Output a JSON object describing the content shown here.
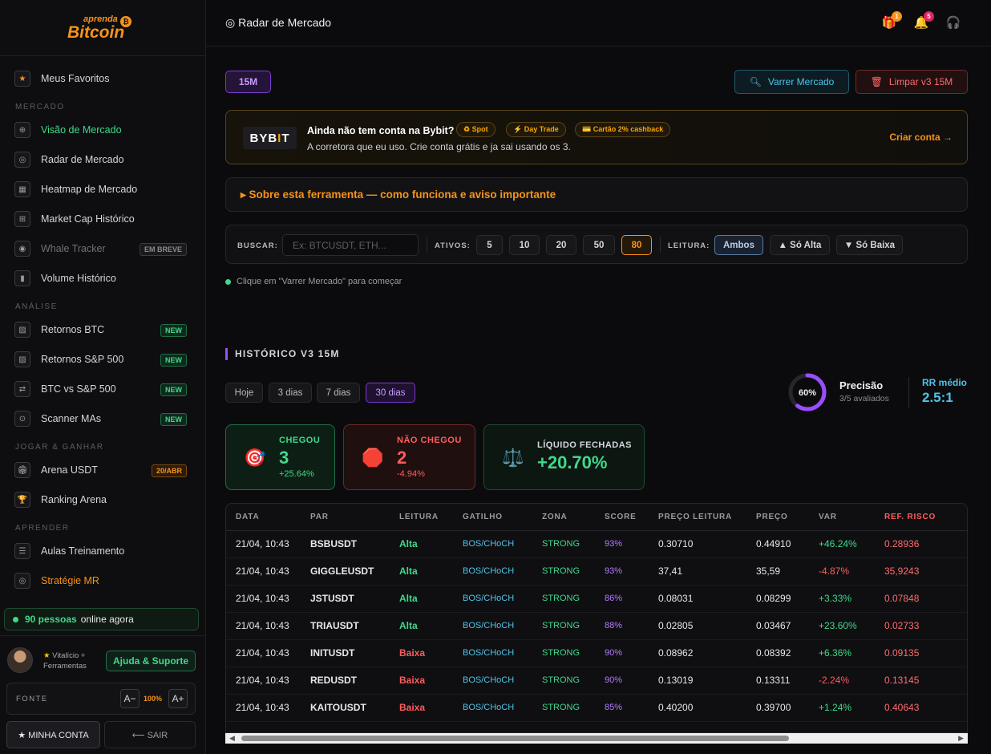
{
  "logo": {
    "top": "aprenda",
    "main": "Bitcoin",
    "coin": "₿"
  },
  "sidebar": {
    "favorites": "Meus Favoritos",
    "sections": {
      "mercado": "MERCADO",
      "analise": "ANÁLISE",
      "jogar": "JOGAR & GANHAR",
      "aprender": "APRENDER"
    },
    "items": [
      {
        "label": "Visão de Mercado",
        "color": "#3fd98a"
      },
      {
        "label": "Radar de Mercado"
      },
      {
        "label": "Heatmap de Mercado"
      },
      {
        "label": "Market Cap Histórico"
      },
      {
        "label": "Whale Tracker",
        "badge": "EM BREVE"
      },
      {
        "label": "Volume Histórico"
      },
      {
        "label": "Retornos BTC",
        "badge": "NEW"
      },
      {
        "label": "Retornos S&P 500",
        "badge": "NEW"
      },
      {
        "label": "BTC vs S&P 500",
        "badge": "NEW"
      },
      {
        "label": "Scanner MAs",
        "badge": "NEW"
      },
      {
        "label": "Arena USDT",
        "badge": "20/ABR"
      },
      {
        "label": "Ranking Arena"
      },
      {
        "label": "Aulas Treinamento"
      },
      {
        "label": "Stratégie MR",
        "color": "#f7931a"
      }
    ],
    "online_count": "90 pessoas",
    "online_text": "online agora",
    "plan_line1": "Vitalício +",
    "plan_line2": "Ferramentas",
    "help": "Ajuda & Suporte",
    "font_label": "FONTE",
    "font_minus": "A−",
    "font_pct": "100%",
    "font_plus": "A+",
    "account": "★ MINHA CONTA",
    "logout": "⟵ SAIR"
  },
  "topbar": {
    "title": "◎ Radar de Mercado",
    "gift_count": "1",
    "bell_count": "5"
  },
  "controls": {
    "timeframe": "15M",
    "sweep": "Varrer Mercado",
    "clear": "Limpar v3 15M"
  },
  "promo": {
    "brand_a": "BYB",
    "brand_b": "I",
    "brand_c": "T",
    "title": "Ainda não tem conta na Bybit?",
    "chips": [
      "♻ Spot",
      "⚡ Day Trade",
      "💳 Cartão 2% cashback"
    ],
    "subtitle": "A corretora que eu uso. Crie conta grátis e ja sai usando os 3.",
    "cta": "Criar conta →"
  },
  "about": "▸ Sobre esta ferramenta — como funciona e aviso importante",
  "filters": {
    "search_label": "BUSCAR:",
    "search_placeholder": "Ex: BTCUSDT, ETH...",
    "assets_label": "ATIVOS:",
    "assets": [
      "5",
      "10",
      "20",
      "50",
      "80"
    ],
    "assets_selected": "80",
    "reading_label": "LEITURA:",
    "readings": [
      "Ambos",
      "▲ Só Alta",
      "▼ Só Baixa"
    ]
  },
  "hint": "Clique em \"Varrer Mercado\" para começar",
  "history": {
    "title": "HISTÓRICO V3 15M",
    "ranges": [
      "Hoje",
      "3 dias",
      "7 dias",
      "30 dias"
    ],
    "range_selected": "30 dias",
    "precision_pct": "60%",
    "precision_value": 0.6,
    "precision_label": "Precisão",
    "precision_sub": "3/5 avaliados",
    "rr_label": "RR médio",
    "rr_value": "2.5:1"
  },
  "cards": {
    "hit": {
      "icon": "🎯",
      "title": "CHEGOU",
      "value": "3",
      "sub": "+25.64%"
    },
    "miss": {
      "icon": "🛑",
      "title": "NÃO CHEGOU",
      "value": "2",
      "sub": "-4.94%"
    },
    "net": {
      "icon": "⚖️",
      "title": "LÍQUIDO FECHADAS",
      "value": "+20.70%"
    }
  },
  "table": {
    "headers": [
      "DATA",
      "PAR",
      "LEITURA",
      "GATILHO",
      "ZONA",
      "SCORE",
      "PREÇO LEITURA",
      "PREÇO",
      "VAR",
      "REF. RISCO"
    ],
    "rows": [
      [
        "21/04, 10:43",
        "BSBUSDT",
        "Alta",
        "BOS/CHoCH",
        "STRONG",
        "93%",
        "0.30710",
        "0.44910",
        "+46.24%",
        "0.28936"
      ],
      [
        "21/04, 10:43",
        "GIGGLEUSDT",
        "Alta",
        "BOS/CHoCH",
        "STRONG",
        "93%",
        "37,41",
        "35,59",
        "-4.87%",
        "35,9243"
      ],
      [
        "21/04, 10:43",
        "JSTUSDT",
        "Alta",
        "BOS/CHoCH",
        "STRONG",
        "86%",
        "0.08031",
        "0.08299",
        "+3.33%",
        "0.07848"
      ],
      [
        "21/04, 10:43",
        "TRIAUSDT",
        "Alta",
        "BOS/CHoCH",
        "STRONG",
        "88%",
        "0.02805",
        "0.03467",
        "+23.60%",
        "0.02733"
      ],
      [
        "21/04, 10:43",
        "INITUSDT",
        "Baixa",
        "BOS/CHoCH",
        "STRONG",
        "90%",
        "0.08962",
        "0.08392",
        "+6.36%",
        "0.09135"
      ],
      [
        "21/04, 10:43",
        "REDUSDT",
        "Baixa",
        "BOS/CHoCH",
        "STRONG",
        "90%",
        "0.13019",
        "0.13311",
        "-2.24%",
        "0.13145"
      ],
      [
        "21/04, 10:43",
        "KAITOUSDT",
        "Baixa",
        "BOS/CHoCH",
        "STRONG",
        "85%",
        "0.40200",
        "0.39700",
        "+1.24%",
        "0.40643"
      ]
    ]
  },
  "colors": {
    "accent": "#f7931a",
    "green": "#3fd98a",
    "red": "#ff5c5c",
    "purple": "#9a4dff",
    "cyan": "#4fc3e8"
  }
}
